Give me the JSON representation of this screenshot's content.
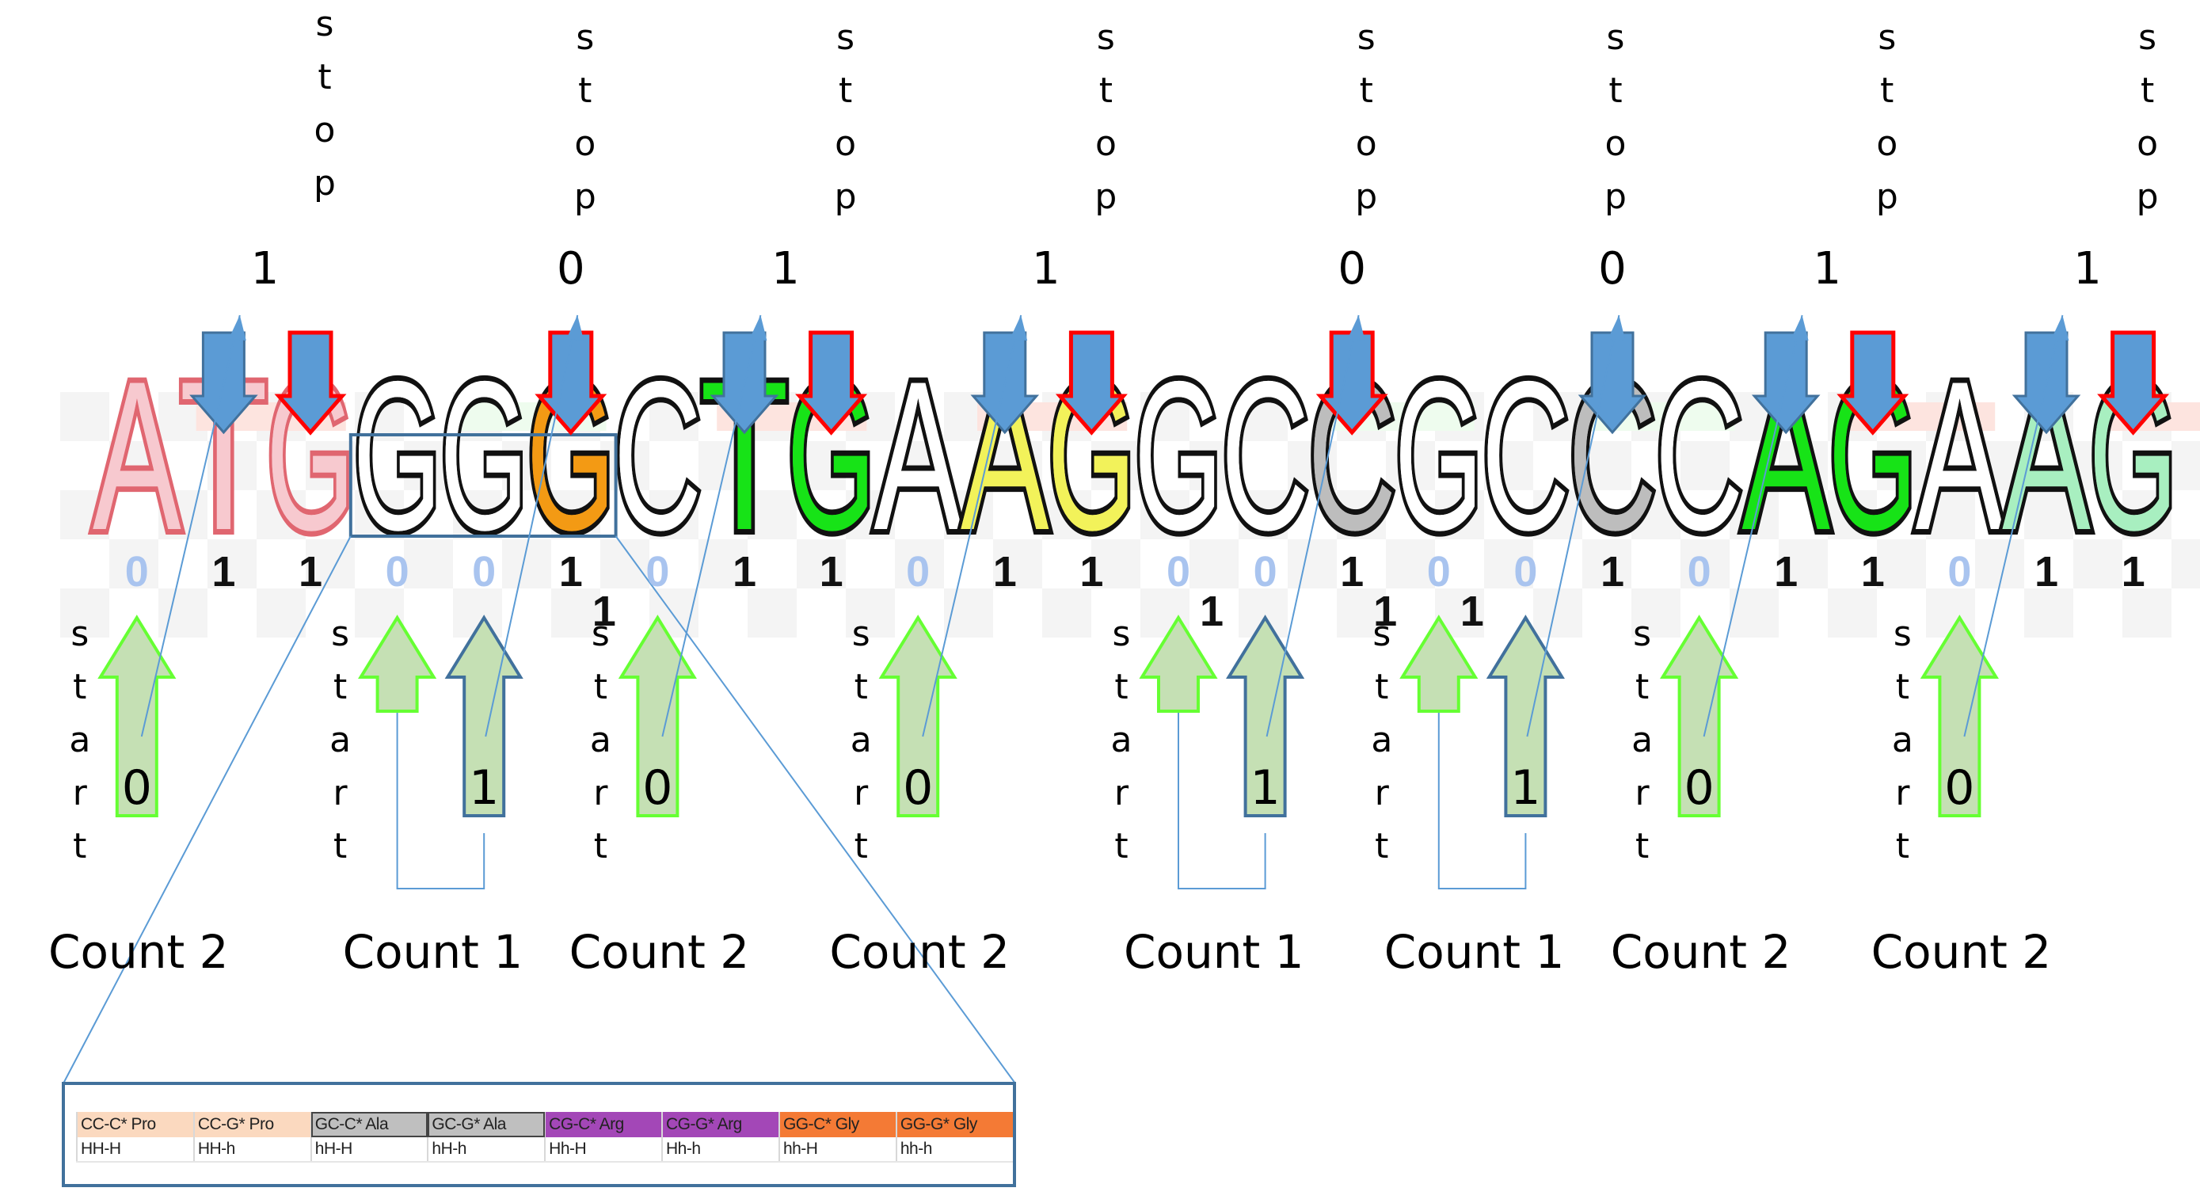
{
  "figure": {
    "sequence": [
      {
        "base": "A",
        "color": "#f7c9cf",
        "stroke": "#e06670",
        "bit": "0"
      },
      {
        "base": "T",
        "color": "#f7c9cf",
        "stroke": "#e06670",
        "bit": "1"
      },
      {
        "base": "G",
        "color": "#f7c9cf",
        "stroke": "#e06670",
        "bit": "1"
      },
      {
        "base": "G",
        "color": "#ffffff",
        "stroke": "#111111",
        "bit": "0"
      },
      {
        "base": "G",
        "color": "#ffffff",
        "stroke": "#111111",
        "bit": "0"
      },
      {
        "base": "G",
        "color": "#f39a14",
        "stroke": "#111111",
        "bit": "1"
      },
      {
        "base": "C",
        "color": "#ffffff",
        "stroke": "#111111",
        "bit": "0"
      },
      {
        "base": "T",
        "color": "#17e317",
        "stroke": "#111111",
        "bit": "1"
      },
      {
        "base": "G",
        "color": "#17e317",
        "stroke": "#111111",
        "bit": "1"
      },
      {
        "base": "A",
        "color": "#ffffff",
        "stroke": "#111111",
        "bit": "0"
      },
      {
        "base": "A",
        "color": "#f2f25a",
        "stroke": "#111111",
        "bit": "1"
      },
      {
        "base": "G",
        "color": "#f2f25a",
        "stroke": "#111111",
        "bit": "1"
      },
      {
        "base": "G",
        "color": "#ffffff",
        "stroke": "#111111",
        "bit": "0"
      },
      {
        "base": "C",
        "color": "#ffffff",
        "stroke": "#111111",
        "bit": "0"
      },
      {
        "base": "C",
        "color": "#bdbdbd",
        "stroke": "#111111",
        "bit": "1"
      },
      {
        "base": "G",
        "color": "#ffffff",
        "stroke": "#111111",
        "bit": "0"
      },
      {
        "base": "C",
        "color": "#ffffff",
        "stroke": "#111111",
        "bit": "0"
      },
      {
        "base": "C",
        "color": "#bdbdbd",
        "stroke": "#111111",
        "bit": "1"
      },
      {
        "base": "C",
        "color": "#ffffff",
        "stroke": "#111111",
        "bit": "0"
      },
      {
        "base": "A",
        "color": "#17e317",
        "stroke": "#111111",
        "bit": "1"
      },
      {
        "base": "G",
        "color": "#17e317",
        "stroke": "#111111",
        "bit": "1"
      },
      {
        "base": "A",
        "color": "#ffffff",
        "stroke": "#111111",
        "bit": "0"
      },
      {
        "base": "A",
        "color": "#a8efc0",
        "stroke": "#111111",
        "bit": "1"
      },
      {
        "base": "G",
        "color": "#a8efc0",
        "stroke": "#111111",
        "bit": "1"
      }
    ],
    "bit_colors": {
      "zero": "#a9c4ef",
      "one": "#111111"
    },
    "stop_label": "stop",
    "start_label": "start",
    "stop_markers": [
      {
        "value": "1",
        "blue_arrow_at": 1,
        "red_arrow_at": 2
      },
      {
        "value": "0",
        "blue_arrow_at": null,
        "red_arrow_at": 5
      },
      {
        "value": "1",
        "blue_arrow_at": 7,
        "red_arrow_at": 8
      },
      {
        "value": "1",
        "blue_arrow_at": 10,
        "red_arrow_at": 11
      },
      {
        "value": "0",
        "blue_arrow_at": null,
        "red_arrow_at": 14
      },
      {
        "value": "0",
        "blue_arrow_at": 17,
        "red_arrow_at": null
      },
      {
        "value": "1",
        "blue_arrow_at": 19,
        "red_arrow_at": 20
      },
      {
        "value": "1",
        "blue_arrow_at": 22,
        "red_arrow_at": 23
      }
    ],
    "start_markers": [
      {
        "value": "0",
        "green_arrow_at": 0,
        "blue_arrow_at": null,
        "count": "Count 2"
      },
      {
        "value": "1",
        "green_arrow_at": 3,
        "blue_arrow_at": 4,
        "count": "Count 1"
      },
      {
        "value": "0",
        "green_arrow_at": 6,
        "blue_arrow_at": null,
        "count": "Count 2"
      },
      {
        "value": "0",
        "green_arrow_at": 9,
        "blue_arrow_at": null,
        "count": "Count 2"
      },
      {
        "value": "1",
        "green_arrow_at": 12,
        "blue_arrow_at": 13,
        "count": "Count 1"
      },
      {
        "value": "1",
        "green_arrow_at": 15,
        "blue_arrow_at": 16,
        "count": "Count 1"
      },
      {
        "value": "0",
        "green_arrow_at": 18,
        "blue_arrow_at": null,
        "count": "Count 2"
      },
      {
        "value": "0",
        "green_arrow_at": 21,
        "blue_arrow_at": null,
        "count": "Count 2"
      }
    ],
    "stray_ones": [
      {
        "near_index": 5,
        "value": "1"
      },
      {
        "near_index": 12,
        "value": "1"
      },
      {
        "near_index": 14,
        "value": "1"
      },
      {
        "near_index": 15,
        "value": "1"
      }
    ],
    "highlight_box": {
      "from_index": 3,
      "to_index": 5
    },
    "band_colors": {
      "pink": "#fde4df",
      "green": "#eefcee",
      "checker": "#f4f4f4"
    },
    "bands": [
      {
        "from_index": 1,
        "to_index": 2,
        "tone": "pink"
      },
      {
        "from_index": 4,
        "to_index": 5,
        "tone": "green"
      },
      {
        "from_index": 7,
        "to_index": 8,
        "tone": "pink"
      },
      {
        "from_index": 10,
        "to_index": 11,
        "tone": "pink"
      },
      {
        "from_index": 14,
        "to_index": 15,
        "tone": "green"
      },
      {
        "from_index": 17,
        "to_index": 18,
        "tone": "green"
      },
      {
        "from_index": 20,
        "to_index": 21,
        "tone": "pink"
      },
      {
        "from_index": 23,
        "to_index": 24,
        "tone": "pink"
      }
    ],
    "arrow_colors": {
      "blue_fill": "#5b9bd5",
      "blue_stroke": "#41719c",
      "red_stroke": "#ff0000",
      "green_fill": "#c5e0b4",
      "green_stroke": "#66ff33",
      "connector": "#5b9bd5"
    }
  },
  "legend": {
    "headers": [
      {
        "text": "CC-C* Pro",
        "bg": "#fbd9bf"
      },
      {
        "text": "CC-G* Pro",
        "bg": "#fbd9bf"
      },
      {
        "text": "GC-C* Ala",
        "bg": "#bfbfbf",
        "boxed": true
      },
      {
        "text": "GC-G* Ala",
        "bg": "#bfbfbf",
        "boxed": true
      },
      {
        "text": "CG-C* Arg",
        "bg": "#a347b7"
      },
      {
        "text": "CG-G* Arg",
        "bg": "#a347b7"
      },
      {
        "text": "GG-C* Gly",
        "bg": "#f47a35"
      },
      {
        "text": "GG-G* Gly",
        "bg": "#f47a35"
      }
    ],
    "codes": [
      "HH-H",
      "HH-h",
      "hH-H",
      "hH-h",
      "Hh-H",
      "Hh-h",
      "hh-H",
      "hh-h"
    ]
  }
}
